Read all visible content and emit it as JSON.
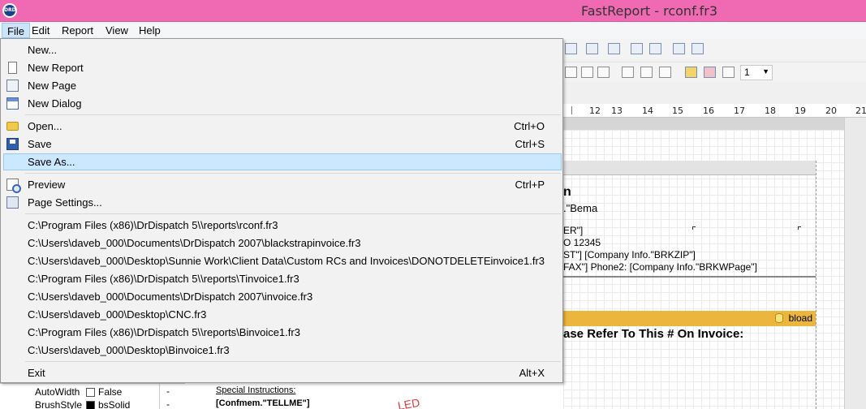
{
  "window": {
    "title": "FastReport - rconf.fr3",
    "icon_text": "DRD"
  },
  "menubar": {
    "items": [
      "File",
      "Edit",
      "Report",
      "View",
      "Help"
    ]
  },
  "toolbar": {
    "line_width": "1"
  },
  "ruler": {
    "ticks": [
      "12",
      "13",
      "14",
      "15",
      "16",
      "17",
      "18",
      "19",
      "20",
      "21"
    ]
  },
  "file_menu": {
    "group1": [
      {
        "label": "New...",
        "icon": "none"
      },
      {
        "label": "New Report",
        "icon": "new-report-icon"
      },
      {
        "label": "New Page",
        "icon": "new-page-icon"
      },
      {
        "label": "New Dialog",
        "icon": "new-dialog-icon"
      }
    ],
    "group2": [
      {
        "label": "Open...",
        "shortcut": "Ctrl+O",
        "icon": "open-folder-icon"
      },
      {
        "label": "Save",
        "shortcut": "Ctrl+S",
        "icon": "save-disk-icon"
      },
      {
        "label": "Save As...",
        "shortcut": "",
        "icon": "none"
      }
    ],
    "group3": [
      {
        "label": "Preview",
        "shortcut": "Ctrl+P",
        "icon": "preview-icon"
      },
      {
        "label": "Page Settings...",
        "shortcut": "",
        "icon": "page-settings-icon"
      }
    ],
    "recent": [
      "C:\\Program Files (x86)\\DrDispatch 5\\\\reports\\rconf.fr3",
      "C:\\Users\\daveb_000\\Documents\\DrDispatch 2007\\blackstrapinvoice.fr3",
      "C:\\Users\\daveb_000\\Desktop\\Sunnie Work\\Client Data\\Custom RCs and Invoices\\DONOTDELETEinvoice1.fr3",
      "C:\\Program Files (x86)\\DrDispatch 5\\\\reports\\Tinvoice1.fr3",
      "C:\\Users\\daveb_000\\Documents\\DrDispatch 2007\\invoice.fr3",
      "C:\\Users\\daveb_000\\Desktop\\CNC.fr3",
      "C:\\Program Files (x86)\\DrDispatch 5\\\\reports\\Binvoice1.fr3",
      "C:\\Users\\daveb_000\\Desktop\\Binvoice1.fr3"
    ],
    "exit": {
      "label": "Exit",
      "shortcut": "Alt+X"
    }
  },
  "report": {
    "heading_fragment": "n",
    "line1": ".\"Bema",
    "line2": "ER\"]",
    "line3": "O 12345",
    "line4": "ST\"]  [Company Info.\"BRKZIP\"]",
    "line5": "FAX\"]   Phone2:  [Company Info.\"BRKWPage\"]",
    "band_label": "bload",
    "please_refer": "ase Refer To This # On Invoice:",
    "special_instructions": "Special Instructions:",
    "confmem": "[Confmem.\"TELLME\"]",
    "stamp": "LED"
  },
  "inspector": {
    "rows": [
      {
        "name": "AutoWidth",
        "value": "False"
      },
      {
        "name": "BrushStyle",
        "value": "bsSolid"
      }
    ],
    "side_marks": [
      "-",
      "-"
    ]
  }
}
